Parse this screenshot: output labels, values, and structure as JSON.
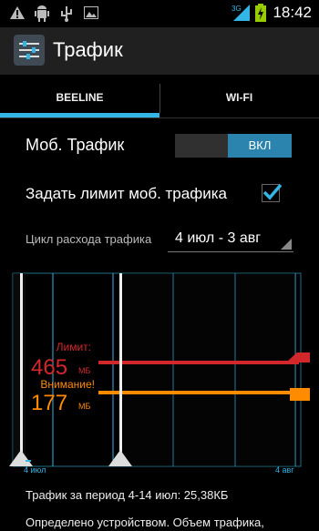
{
  "status_bar": {
    "time": "18:42",
    "network_type": "3G",
    "icons": [
      "warning-icon",
      "android-icon",
      "usb-icon",
      "image-icon",
      "network-icon",
      "battery-icon"
    ]
  },
  "action_bar": {
    "title": "Трафик",
    "icon": "settings-sliders-icon"
  },
  "tabs": [
    {
      "label": "BEELINE",
      "selected": true
    },
    {
      "label": "WI-FI",
      "selected": false
    }
  ],
  "mobile_traffic": {
    "label": "Моб. Трафик",
    "toggle_value": "ВКЛ"
  },
  "limit": {
    "label": "Задать лимит моб. трафика",
    "checked": true
  },
  "cycle": {
    "label": "Цикл расхода трафика",
    "value": "4 июл - 3 авг"
  },
  "chart": {
    "limit_label": "Лимит:",
    "limit_value": "465",
    "limit_unit": "МБ",
    "warning_label": "Внимание!",
    "warning_value": "177",
    "warning_unit": "МБ",
    "start_label": "4 июл",
    "end_label": "4 авг",
    "colors": {
      "limit": "#d2282c",
      "warning": "#ff8c00",
      "grid": "#33b5e5"
    }
  },
  "stats": {
    "period": "Трафик за период 4-14 июл: 25,38КБ",
    "note": "Определено устройством. Объем трафика,"
  }
}
